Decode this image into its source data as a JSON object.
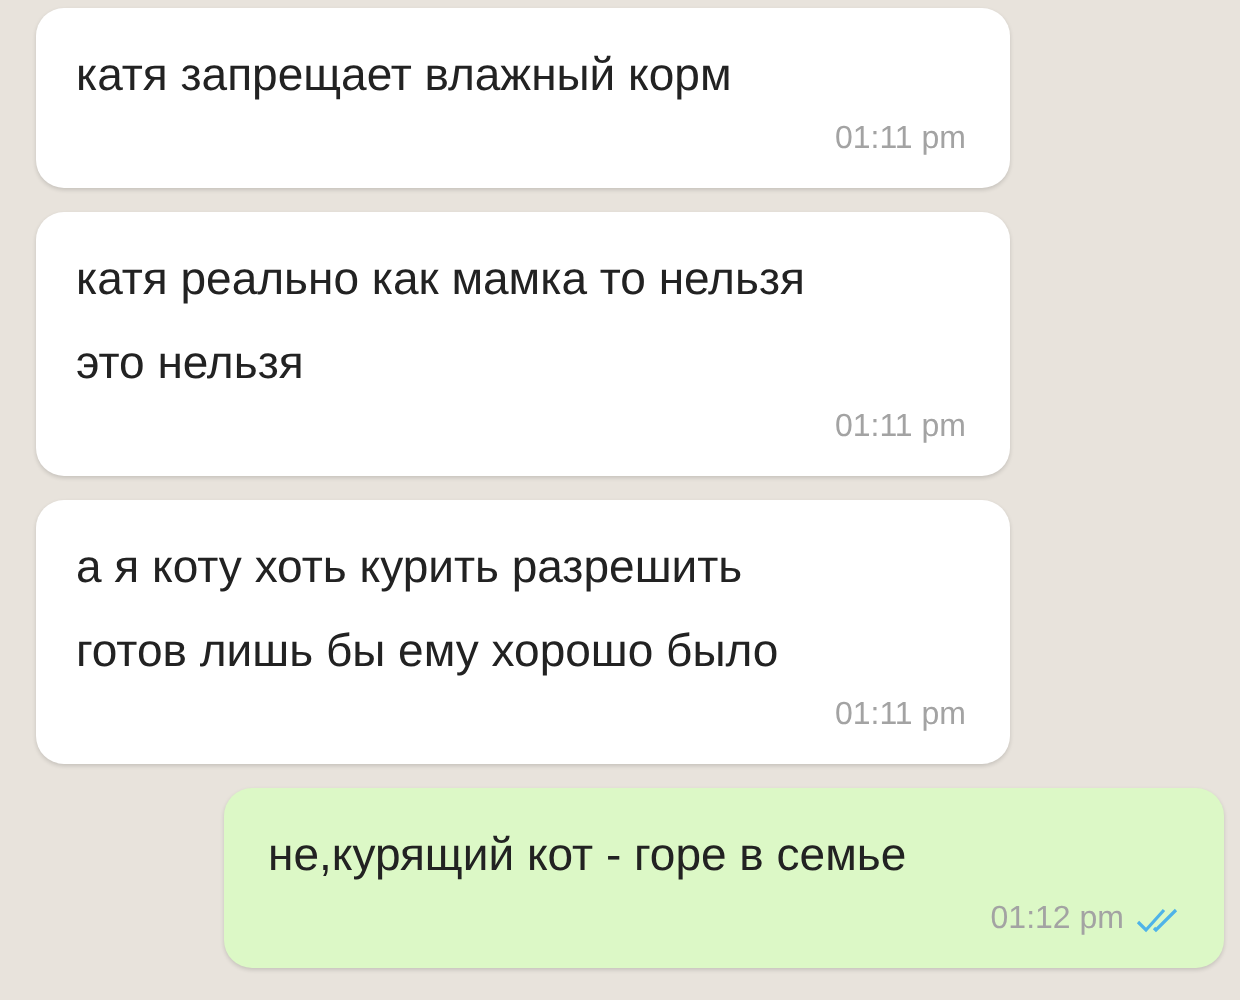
{
  "messages": [
    {
      "kind": "incoming",
      "text": "катя запрещает влажный корм",
      "time": "01:11 pm"
    },
    {
      "kind": "incoming",
      "lines": [
        "катя реально как мамка то нельзя",
        "это нельзя"
      ],
      "time": "01:11 pm"
    },
    {
      "kind": "incoming",
      "lines": [
        "а я коту хоть курить разрешить",
        "готов лишь бы ему хорошо было"
      ],
      "time": "01:11 pm"
    },
    {
      "kind": "outgoing",
      "text": "не,курящий кот - горе в семье",
      "time": "01:12 pm",
      "read": true
    }
  ]
}
